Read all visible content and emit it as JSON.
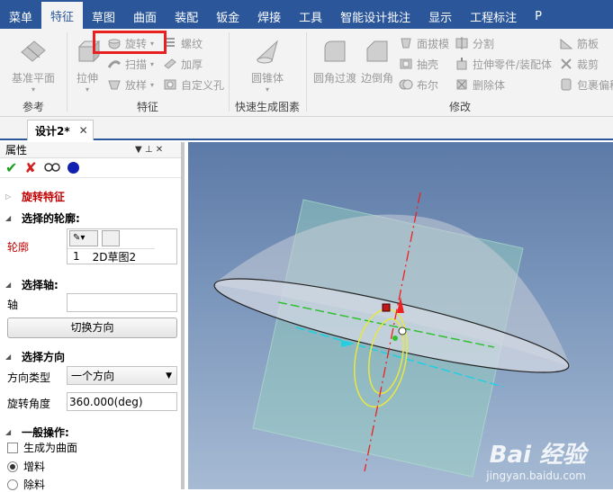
{
  "menu": {
    "tabs": [
      "菜单",
      "特征",
      "草图",
      "曲面",
      "装配",
      "钣金",
      "焊接",
      "工具",
      "智能设计批注",
      "显示",
      "工程标注",
      "P"
    ],
    "active_index": 1
  },
  "ribbon": {
    "reference": {
      "label": "参考",
      "plane_label": "基准平面"
    },
    "feature": {
      "label": "特征",
      "extrude_label": "拉伸",
      "revolve_label": "旋转",
      "sweep_label": "扫描",
      "loft_label": "放样",
      "helix_label": "螺纹",
      "thicken_label": "加厚",
      "custom_hole_label": "自定义孔"
    },
    "quick": {
      "label": "快速生成图素",
      "cone_label": "圆锥体"
    },
    "modify": {
      "label": "修改",
      "fillet_label": "圆角过渡",
      "chamfer_label": "边倒角",
      "draft_label": "面拔模",
      "shell_label": "抽壳",
      "boolean_label": "布尔",
      "split_label": "分割",
      "extrude_part_label": "拉伸零件/装配体",
      "delete_body_label": "删除体",
      "rib_label": "筋板",
      "trim_label": "裁剪",
      "wrap_label": "包裹偏移"
    }
  },
  "document": {
    "tab_label": "设计2*",
    "close_symbol": "✕"
  },
  "panel": {
    "title": "属性",
    "header_ctrl": "▼  ⊥  ✕",
    "feature_title": "旋转特征",
    "profile_section": "选择的轮廓:",
    "profile_label": "轮廓",
    "profile_item_index": "1",
    "profile_item_name": "2D草图2",
    "axis_section": "选择轴:",
    "axis_label": "轴",
    "axis_value": "",
    "flip_button": "切换方向",
    "direction_section": "选择方向",
    "direction_type_label": "方向类型",
    "direction_type_value": "一个方向",
    "angle_label": "旋转角度",
    "angle_value": "360.000(deg)",
    "general_section": "一般操作:",
    "as_surface_label": "生成为曲面",
    "add_label": "增料",
    "remove_label": "除料"
  },
  "watermark": {
    "brand": "Bai 经验",
    "url": "jingyan.baidu.com"
  },
  "colors": {
    "accent": "#2b579a",
    "highlight": "#e82020",
    "ok": "#1e9e1e",
    "cancel": "#d32020"
  }
}
